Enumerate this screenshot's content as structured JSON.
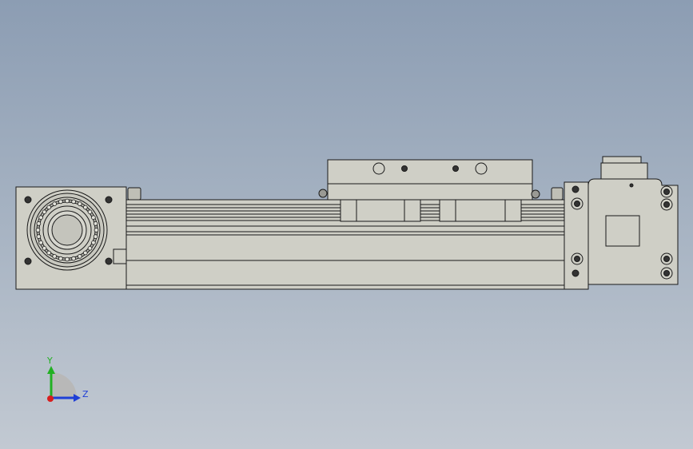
{
  "viewport": {
    "background_top": "#8c9db3",
    "background_bottom": "#c2c9d2",
    "part_fill": "#cfcfc6",
    "part_fill_dark": "#b9b9b0",
    "edge_color": "#1a1a1a"
  },
  "triad": {
    "y_label": "Y",
    "z_label": "Z",
    "y_color": "#22b022",
    "z_color": "#1f3fd6",
    "x_color": "#d81e1e"
  }
}
